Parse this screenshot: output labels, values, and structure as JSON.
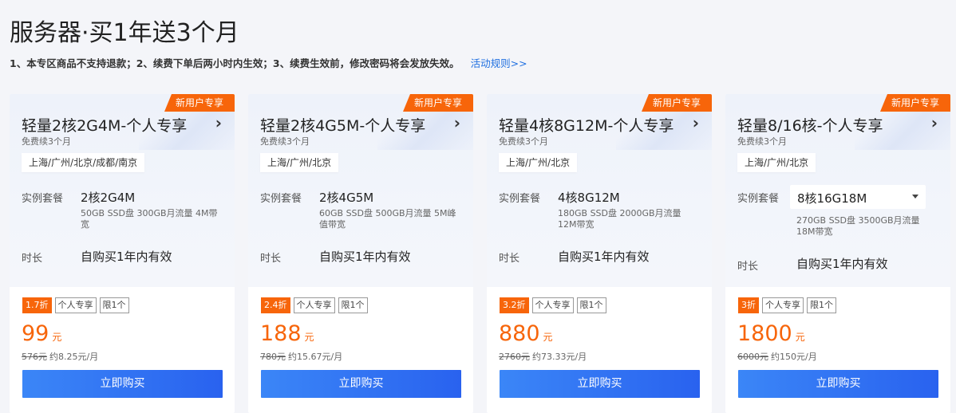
{
  "header": {
    "title": "服务器·买1年送3个月",
    "notice": "1、本专区商品不支持退款；2、续费下单后两小时内生效；3、续费生效前，修改密码将会发放失效。",
    "rules_link": "活动规则>>"
  },
  "labels": {
    "spec": "实例套餐",
    "duration": "时长",
    "currency": "元",
    "buy": "立即购买",
    "chevron": "›"
  },
  "cards": [
    {
      "ribbon": "新用户专享",
      "name": "轻量2核2G4M-个人专享",
      "free_note": "免费续3个月",
      "regions": "上海/广州/北京/成都/南京",
      "spec": "2核2G4M",
      "spec_detail": "50GB SSD盘 300GB月流量 4M带宽",
      "duration": "自购买1年内有效",
      "discount": "1.7折",
      "tag1": "个人专享",
      "tag2": "限1个",
      "price": "99",
      "orig_price": "576元",
      "monthly": "约8.25元/月"
    },
    {
      "ribbon": "新用户专享",
      "name": "轻量2核4G5M-个人专享",
      "free_note": "免费续3个月",
      "regions": "上海/广州/北京",
      "spec": "2核4G5M",
      "spec_detail": "60GB SSD盘 500GB月流量 5M峰值带宽",
      "duration": "自购买1年内有效",
      "discount": "2.4折",
      "tag1": "个人专享",
      "tag2": "限1个",
      "price": "188",
      "orig_price": "780元",
      "monthly": "约15.67元/月"
    },
    {
      "ribbon": "新用户专享",
      "name": "轻量4核8G12M-个人专享",
      "free_note": "免费续3个月",
      "regions": "上海/广州/北京",
      "spec": "4核8G12M",
      "spec_detail": "180GB SSD盘 2000GB月流量 12M带宽",
      "duration": "自购买1年内有效",
      "discount": "3.2折",
      "tag1": "个人专享",
      "tag2": "限1个",
      "price": "880",
      "orig_price": "2760元",
      "monthly": "约73.33元/月"
    },
    {
      "ribbon": "新用户专享",
      "name": "轻量8/16核-个人专享",
      "free_note": "免费续3个月",
      "regions": "上海/广州/北京",
      "spec": "8核16G18M",
      "spec_detail": "270GB SSD盘 3500GB月流量 18M带宽",
      "duration": "自购买1年内有效",
      "discount": "3折",
      "tag1": "个人专享",
      "tag2": "限1个",
      "price": "1800",
      "orig_price": "6000元",
      "monthly": "约150元/月"
    }
  ],
  "colors": {
    "accent_orange": "#f7650a",
    "button_blue": "#2962ef",
    "link_blue": "#1f6fe0"
  }
}
